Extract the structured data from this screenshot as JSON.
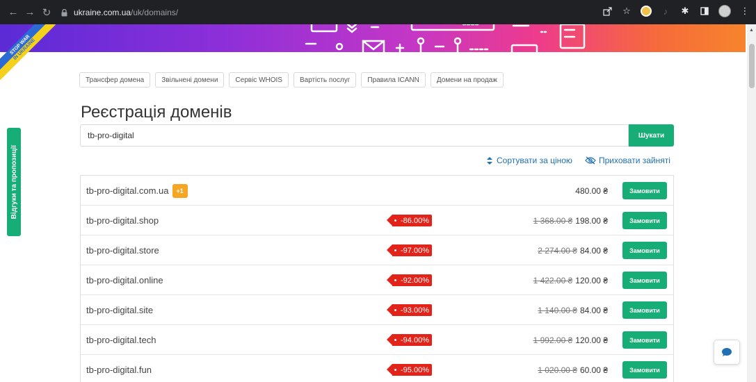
{
  "browser": {
    "url_host": "ukraine.com.ua",
    "url_path": "/uk/domains/"
  },
  "ribbon": {
    "line1": "STOP WAR",
    "line2": "IN UKRAINE"
  },
  "feedback_tab": {
    "label": "Відгуки та пропозиції"
  },
  "subnav": [
    {
      "label": "Трансфер домена"
    },
    {
      "label": "Звільнені домени"
    },
    {
      "label": "Сервіс WHOIS"
    },
    {
      "label": "Вартість послуг"
    },
    {
      "label": "Правила ICANN"
    },
    {
      "label": "Домени на продаж"
    }
  ],
  "page_title": "Реєстрація доменів",
  "search": {
    "value": "tb-pro-digital",
    "button_label": "Шукати"
  },
  "sort_label": "Сортувати за ціною",
  "hide_label": "Приховати зайняті",
  "order_label": "Замовити",
  "results": [
    {
      "domain": "tb-pro-digital.com.ua",
      "badge": "+1",
      "discount": "",
      "old_price": "",
      "price": "480.00 ₴"
    },
    {
      "domain": "tb-pro-digital.shop",
      "badge": "",
      "discount": "-86.00%",
      "old_price": "1 368.00 ₴",
      "price": "198.00 ₴"
    },
    {
      "domain": "tb-pro-digital.store",
      "badge": "",
      "discount": "-97.00%",
      "old_price": "2 274.00 ₴",
      "price": "84.00 ₴"
    },
    {
      "domain": "tb-pro-digital.online",
      "badge": "",
      "discount": "-92.00%",
      "old_price": "1 422.00 ₴",
      "price": "120.00 ₴"
    },
    {
      "domain": "tb-pro-digital.site",
      "badge": "",
      "discount": "-93.00%",
      "old_price": "1 140.00 ₴",
      "price": "84.00 ₴"
    },
    {
      "domain": "tb-pro-digital.tech",
      "badge": "",
      "discount": "-94.00%",
      "old_price": "1 992.00 ₴",
      "price": "120.00 ₴"
    },
    {
      "domain": "tb-pro-digital.fun",
      "badge": "",
      "discount": "-95.00%",
      "old_price": "1 020.00 ₴",
      "price": "60.00 ₴"
    }
  ],
  "colors": {
    "accent_green": "#17ad76",
    "discount_red": "#e2231a",
    "link_blue": "#1f6fb2",
    "badge_orange": "#f5a623"
  }
}
